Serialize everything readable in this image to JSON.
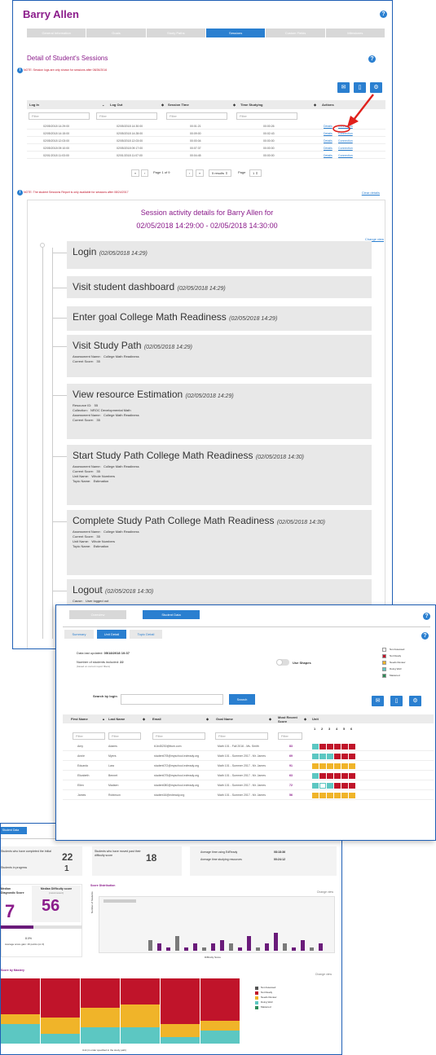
{
  "p1": {
    "title": "Barry Allen",
    "tabs": [
      "General Information",
      "Goals",
      "Study Paths",
      "Sessions",
      "Custom Fields",
      "Milestones"
    ],
    "section_title": "Detail of Student's Sessions",
    "note1": "NOTE: Session logs are only shown for sessions after 08/26/2016",
    "columns": [
      "Log In",
      "Log Out",
      "Session Time",
      "Time Studying",
      "Actions"
    ],
    "filter": "Filter",
    "rows": [
      [
        "02/05/2018 14:29:00",
        "02/05/2018 14:30:00",
        "00:01:21",
        "00:00:26"
      ],
      [
        "02/05/2018 14:15:00",
        "02/05/2018 14:28:00",
        "00:09:00",
        "00:02:43"
      ],
      [
        "02/05/2018 12:03:00",
        "02/05/2018 12:03:00",
        "00:00:04",
        "00:00:00"
      ],
      [
        "02/05/2018 09:10:00",
        "02/05/2018 09:17:00",
        "00:07:37",
        "00:00:00"
      ],
      [
        "02/01/2018 11:03:00",
        "02/01/2018 11:07:00",
        "00:04:45",
        "00:00:00"
      ]
    ],
    "details": "Details",
    "connection": "Connection",
    "pager": "Page 1 of 9",
    "per_page": "5 results",
    "page_label": "Page",
    "page_value": "1",
    "note2": "NOTE: The student Sessions Report is only available for sessions after 08/24/2017",
    "clear": "Clear details",
    "activity_title_1": "Session activity details for Barry Allen for",
    "activity_title_2": "02/05/2018 14:29:00 - 02/05/2018 14:30:00",
    "change_view": "Change view",
    "events": [
      {
        "title": "Login",
        "time": "(02/05/2018 14:29)",
        "detail": ""
      },
      {
        "title": "Visit student dashboard",
        "time": "(02/05/2018 14:29)",
        "detail": ""
      },
      {
        "title": "Enter goal  College Math Readiness",
        "time": "(02/05/2018 14:29)",
        "detail": ""
      },
      {
        "title": "Visit Study Path",
        "time": "(02/05/2018 14:29)",
        "detail": "Assessment Name:   College Math Readiness\nCurrent Score:   35"
      },
      {
        "title": "View resource  Estimation",
        "time": "(02/05/2018 14:29)",
        "detail": "Resource ID:   55\nCollection:   NROC Developmental Math\nAssessment Name:   College Math Readiness\nCurrent Score:   35"
      },
      {
        "title": "Start Study Path  College Math Readiness",
        "time": "(02/05/2018 14:30)",
        "detail": "Assessment Name:   College Math Readiness\nCurrent Score:   35\nUnit Name:   Whole Numbers\nTopic Name:   Estimation"
      },
      {
        "title": "Complete Study Path  College Math Readiness",
        "time": "(02/05/2018 14:30)",
        "detail": "Assessment Name:   College Math Readiness\nCurrent Score:   35\nUnit Name:   Whole Numbers\nTopic Name:   Estimation"
      },
      {
        "title": "Logout",
        "time": "(02/05/2018 14:30)",
        "detail": "Cause:   User logged out"
      }
    ]
  },
  "p2": {
    "tabs": [
      "Overview",
      "Student Data"
    ],
    "subtabs": [
      "Summary",
      "Unit Detail",
      "Topic Detail"
    ],
    "last_updated_label": "Data last updated:",
    "last_updated": "05/18/2018 10:37",
    "num_students_label": "Number of students included:",
    "num_students": "22",
    "num_students_note": "(based on current report filters)",
    "use_shapes": "Use Shapes",
    "legend": [
      {
        "label": "Not Assessed",
        "color": "#ffffff"
      },
      {
        "label": "Not Ready",
        "color": "#c0142a"
      },
      {
        "label": "Needs Review",
        "color": "#f0b429"
      },
      {
        "label": "Doing Well",
        "color": "#5cc7c2"
      },
      {
        "label": "Mastered",
        "color": "#2e8b57"
      }
    ],
    "search_label": "Search by login",
    "search_button": "Search",
    "columns": [
      "First Name",
      "Last Name",
      "Email",
      "Goal Name",
      "Most Recent Score",
      "Unit"
    ],
    "units": [
      "1",
      "2",
      "3",
      "4",
      "5",
      "6"
    ],
    "filter": "Filter",
    "rows": [
      {
        "first": "Amy",
        "last": "Adams",
        "email": "b1b45230@ttum.com",
        "goal": "Math 101 - Fall 2016 - Ms. Smith",
        "score": "83",
        "cells": [
          "#5cc7c2",
          "#c0142a",
          "#c0142a",
          "#c0142a",
          "#c0142a",
          "#c0142a"
        ]
      },
      {
        "first": "Annie",
        "last": "Myers",
        "email": "student078@myschool.edready.org",
        "goal": "Math 101 - Summer 2017 - Mr. James",
        "score": "69",
        "cells": [
          "#5cc7c2",
          "#5cc7c2",
          "#5cc7c2",
          "#c0142a",
          "#c0142a",
          "#c0142a"
        ]
      },
      {
        "first": "Eduardo",
        "last": "Lara",
        "email": "student072@myschool.edready.org",
        "goal": "Math 101 - Summer 2017 - Mr. James",
        "score": "91",
        "cells": [
          "#f0b429",
          "#f0b429",
          "#f0b429",
          "#f0b429",
          "#f0b429",
          "#f0b429"
        ]
      },
      {
        "first": "Elizabeth",
        "last": "Bennet",
        "email": "student075@myschool.edready.org",
        "goal": "Math 101 - Summer 2017 - Mr. James",
        "score": "63",
        "cells": [
          "#5cc7c2",
          "#c0142a",
          "#c0142a",
          "#c0142a",
          "#c0142a",
          "#c0142a"
        ]
      },
      {
        "first": "Ellen",
        "last": "Madsen",
        "email": "student080@myschool.edready.org",
        "goal": "Math 101 - Summer 2017 - Mr. James",
        "score": "72",
        "cells": [
          "#5cc7c2",
          "#ffffff",
          "#5cc7c2",
          "#c0142a",
          "#c0142a",
          "#c0142a"
        ]
      },
      {
        "first": "James",
        "last": "Robinson",
        "email": "student16@edready.org",
        "goal": "Math 101 - Summer 2017 - Mr. James",
        "score": "56",
        "cells": [
          "#f0b429",
          "#f0b429",
          "#f0b429",
          "#f0b429",
          "#f0b429",
          "#f0b429"
        ]
      }
    ]
  },
  "p3": {
    "tab": "Student Data",
    "stat1_label": "Students who have completed the Initial",
    "stat1": "22",
    "stat2_label": "Students in progress",
    "stat2": "1",
    "stat3_label": "Students who have moved past their difficulty score",
    "stat3": "18",
    "avg1_label": "Average time using EdReady",
    "avg1": "08:18:36",
    "avg2_label": "Average time studying resources",
    "avg2": "00:24:12",
    "score_dist": "Score Distribution",
    "change_view": "Change view",
    "median_label": "Median Diagnostic Score",
    "median_value": "7",
    "median_diff_label": "Median Difficulty score",
    "median_diff_sub": "(most recent)",
    "median_diff": "56",
    "pct": "8.0%",
    "avg_gain": "Average score gain: 16 points (on 3)",
    "xaxis": "Difficulty Score",
    "yaxis": "Number of Students",
    "mastery_title": "Score by Mastery",
    "mastery_x": "Unit (in order specified in the study path)",
    "legend": [
      {
        "label": "Not Assessed",
        "color": "#555555"
      },
      {
        "label": "Not Ready",
        "color": "#c0142a"
      },
      {
        "label": "Needs Review",
        "color": "#f0b429"
      },
      {
        "label": "Doing Well",
        "color": "#5cc7c2"
      },
      {
        "label": "Mastered",
        "color": "#2e8b57"
      }
    ],
    "bars": [
      3,
      2,
      1,
      4,
      1,
      2,
      1,
      2,
      3,
      2,
      1,
      4,
      1,
      2,
      5,
      2,
      1,
      3,
      1,
      2
    ]
  }
}
